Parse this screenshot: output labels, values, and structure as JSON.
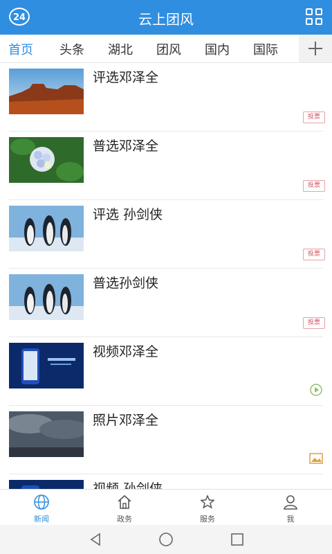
{
  "header": {
    "badge": "24",
    "title": "云上团风"
  },
  "tabs": [
    "首页",
    "头条",
    "湖北",
    "团风",
    "国内",
    "国际"
  ],
  "items": [
    {
      "title": "评选邓泽全",
      "tag": "投票",
      "kind": "vote",
      "image": "desert"
    },
    {
      "title": "普选邓泽全",
      "tag": "投票",
      "kind": "vote",
      "image": "flower"
    },
    {
      "title": "评选 孙剑侠",
      "tag": "投票",
      "kind": "vote",
      "image": "penguins"
    },
    {
      "title": "普选孙剑侠",
      "tag": "投票",
      "kind": "vote",
      "image": "penguins"
    },
    {
      "title": "视频邓泽全",
      "tag": "",
      "kind": "video",
      "image": "screen"
    },
    {
      "title": "照片邓泽全",
      "tag": "",
      "kind": "photo",
      "image": "clouds"
    },
    {
      "title": "视频 孙剑侠",
      "tag": "",
      "kind": "video",
      "image": "screen"
    }
  ],
  "bottom_nav": [
    {
      "label": "新闻",
      "icon": "globe-icon",
      "active": true
    },
    {
      "label": "政务",
      "icon": "house-icon",
      "active": false
    },
    {
      "label": "服务",
      "icon": "star-icon",
      "active": false
    },
    {
      "label": "我",
      "icon": "person-icon",
      "active": false
    }
  ],
  "colors": {
    "accent": "#2f8ee0",
    "tag": "#d05060"
  }
}
